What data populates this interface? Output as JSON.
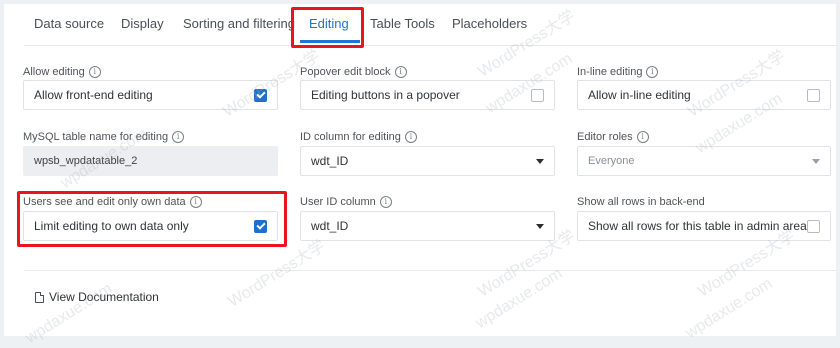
{
  "tabs": [
    {
      "label": "Data source"
    },
    {
      "label": "Display"
    },
    {
      "label": "Sorting and filtering"
    },
    {
      "label": "Editing"
    },
    {
      "label": "Table Tools"
    },
    {
      "label": "Placeholders"
    }
  ],
  "fields": {
    "allow_editing": {
      "label": "Allow editing",
      "value": "Allow front-end editing",
      "checked": true
    },
    "popover_edit": {
      "label": "Popover edit block",
      "value": "Editing buttons in a popover",
      "checked": false
    },
    "inline_editing": {
      "label": "In-line editing",
      "value": "Allow in-line editing",
      "checked": false
    },
    "mysql_table": {
      "label": "MySQL table name for editing",
      "value": "wpsb_wpdatatable_2"
    },
    "id_column": {
      "label": "ID column for editing",
      "value": "wdt_ID"
    },
    "editor_roles": {
      "label": "Editor roles",
      "placeholder": "Everyone"
    },
    "own_data": {
      "label": "Users see and edit only own data",
      "value": "Limit editing to own data only",
      "checked": true
    },
    "user_id_column": {
      "label": "User ID column",
      "value": "wdt_ID"
    },
    "show_all_rows": {
      "label": "Show all rows in back-end",
      "value": "Show all rows for this table in admin area",
      "checked": false
    }
  },
  "footer": {
    "doc_link": "View Documentation"
  },
  "watermark": {
    "text": "WordPress大学",
    "url": "wpdaxue.com"
  },
  "colors": {
    "accent": "#1e74d8",
    "highlight": "#e8141e",
    "checkbox": "#1f6fcf"
  }
}
